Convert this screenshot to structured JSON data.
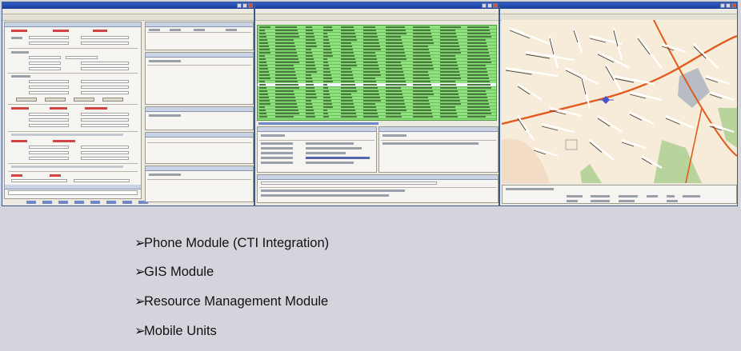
{
  "windows": {
    "phone": {
      "title": "",
      "menu": ""
    },
    "grid": {
      "title": "",
      "menu": ""
    },
    "gis": {
      "title": "",
      "menu": ""
    }
  },
  "bullets": [
    "Phone Module (CTI Integration)",
    "GIS Module",
    "Resource Management Module",
    "Mobile Units"
  ],
  "bullet_marker": "➢",
  "colors": {
    "slide_background": "#d4d5dc",
    "titlebar": "#2e5cc8",
    "grid_highlight": "#8fe37e",
    "map_background": "#f7ecd9",
    "map_roads": "#e35a1e",
    "map_green": "#b9d39c"
  }
}
